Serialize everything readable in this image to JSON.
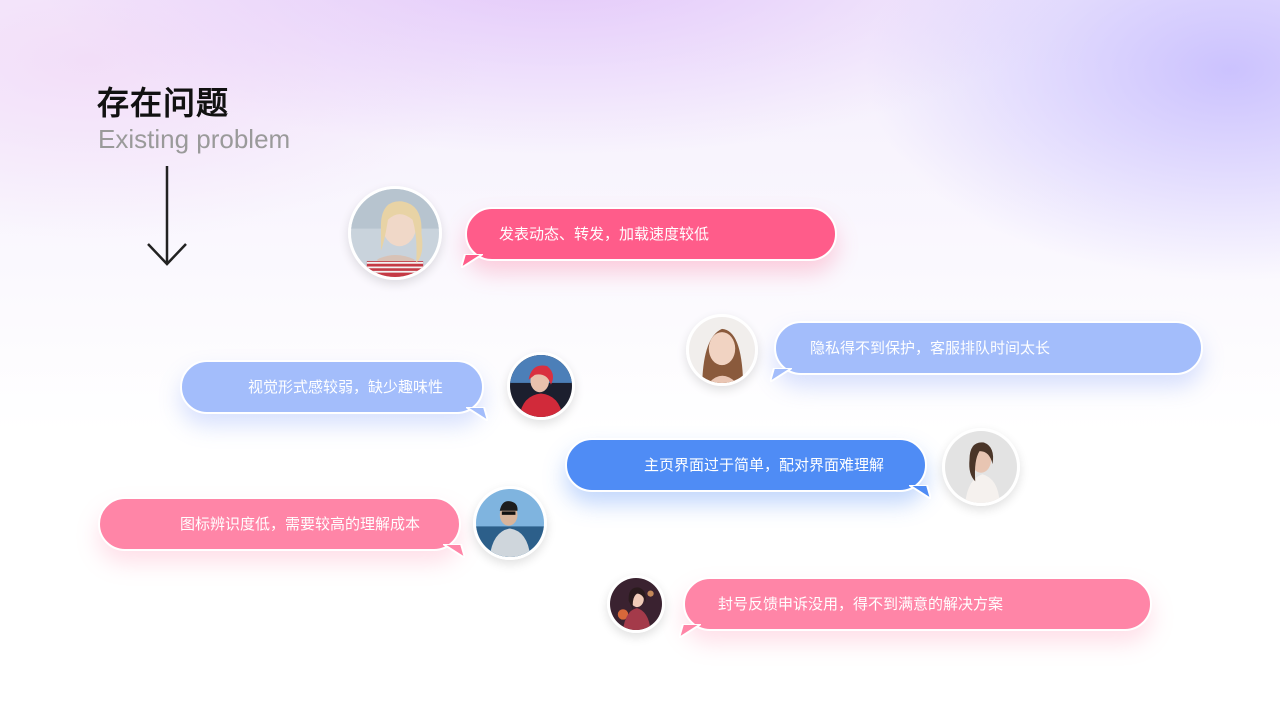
{
  "header": {
    "title": "存在问题",
    "subtitle": "Existing problem"
  },
  "icons": {
    "arrow": "down-arrow-icon"
  },
  "colors": {
    "pink": "#ff5c8a",
    "light_pink": "#ff85a7",
    "lavender": "#a3bdfb",
    "blue": "#4f8cf5"
  },
  "comments": [
    {
      "text": "发表动态、转发，加载速度较低"
    },
    {
      "text": "隐私得不到保护，客服排队时间太长"
    },
    {
      "text": "视觉形式感较弱，缺少趣味性"
    },
    {
      "text": "主页界面过于简单，配对界面难理解"
    },
    {
      "text": "图标辨识度低，需要较高的理解成本"
    },
    {
      "text": "封号反馈申诉没用，得不到满意的解决方案"
    }
  ]
}
